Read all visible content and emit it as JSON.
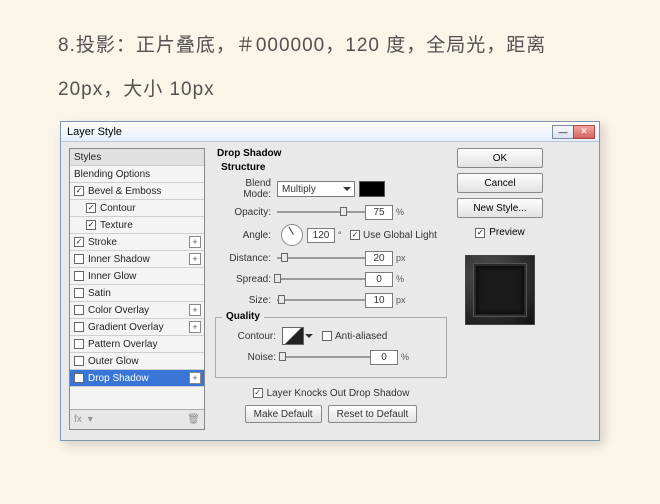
{
  "instruction": "8.投影：正片叠底，＃000000，120 度，全局光，距离 20px，大小 10px",
  "dialog": {
    "title": "Layer Style",
    "styles_head": "Styles",
    "blending": "Blending Options",
    "rows": [
      {
        "label": "Bevel & Emboss",
        "checked": true,
        "plus": false
      },
      {
        "label": "Contour",
        "checked": true,
        "indent": true
      },
      {
        "label": "Texture",
        "checked": true,
        "indent": true
      },
      {
        "label": "Stroke",
        "checked": true,
        "plus": true
      },
      {
        "label": "Inner Shadow",
        "checked": false,
        "plus": true
      },
      {
        "label": "Inner Glow",
        "checked": false
      },
      {
        "label": "Satin",
        "checked": false
      },
      {
        "label": "Color Overlay",
        "checked": false,
        "plus": true
      },
      {
        "label": "Gradient Overlay",
        "checked": false,
        "plus": true
      },
      {
        "label": "Pattern Overlay",
        "checked": false
      },
      {
        "label": "Outer Glow",
        "checked": false
      },
      {
        "label": "Drop Shadow",
        "checked": true,
        "plus": true,
        "sel": true
      }
    ],
    "foot": {
      "fx": "fx",
      "down": "▾",
      "trash": "🗑"
    }
  },
  "ds": {
    "title": "Drop Shadow",
    "structure": "Structure",
    "blend_label": "Blend Mode:",
    "blend_value": "Multiply",
    "color": "#000000",
    "opacity_label": "Opacity:",
    "opacity": "75",
    "pct": "%",
    "angle_label": "Angle:",
    "angle": "120",
    "deg": "°",
    "global": "Use Global Light",
    "distance_label": "Distance:",
    "distance": "20",
    "px": "px",
    "spread_label": "Spread:",
    "spread": "0",
    "size_label": "Size:",
    "size": "10",
    "quality": "Quality",
    "contour_label": "Contour:",
    "aa": "Anti-aliased",
    "noise_label": "Noise:",
    "noise": "0",
    "knock": "Layer Knocks Out Drop Shadow",
    "make_default": "Make Default",
    "reset_default": "Reset to Default"
  },
  "buttons": {
    "ok": "OK",
    "cancel": "Cancel",
    "new_style": "New Style...",
    "preview": "Preview"
  }
}
